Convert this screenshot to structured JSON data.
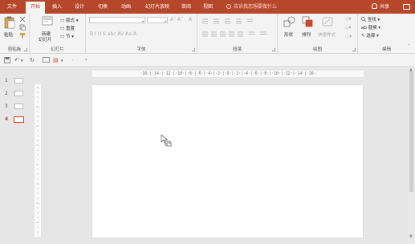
{
  "tabs": [
    "文件",
    "开始",
    "插入",
    "设计",
    "切换",
    "动画",
    "幻灯片放映",
    "审阅",
    "视图"
  ],
  "active_tab": "开始",
  "tell_me": "告诉我您想要做什么",
  "share": "共享",
  "ribbon": {
    "clipboard": {
      "paste": "粘贴",
      "label": "剪贴板"
    },
    "slides": {
      "new_slide": "新建",
      "new_slide_2": "幻灯片",
      "layout": "版式",
      "reset": "重置",
      "section": "节",
      "label": "幻灯片"
    },
    "font": {
      "label": "字体",
      "row2": "B I U S abc AV Aa A"
    },
    "paragraph": {
      "label": "段落"
    },
    "drawing": {
      "shapes": "形状",
      "arrange": "排列",
      "quick_styles": "快速样式",
      "label": "绘图"
    },
    "editing": {
      "find": "查找",
      "replace": "替换",
      "select": "选择",
      "label": "编辑"
    }
  },
  "thumbnails": [
    {
      "num": "1",
      "selected": false
    },
    {
      "num": "2",
      "selected": false
    },
    {
      "num": "3",
      "selected": false
    },
    {
      "num": "4",
      "selected": true
    }
  ],
  "ruler_h": "·16·|·14·|·12·|·10·|·8·|·6·|·4·|·2·|·0·|·2·|·4·|·6·|·8·|·10·|·12·|·14·|·16·",
  "colors": {
    "accent": "#b7472a",
    "selected": "#d24726"
  },
  "icons": [
    "lightbulb-icon",
    "share-person-icon",
    "comment-icon",
    "paste-icon",
    "cut-icon",
    "copy-icon",
    "format-painter-icon",
    "new-slide-icon",
    "shapes-icon",
    "arrange-icon",
    "quick-styles-icon",
    "find-icon",
    "replace-icon",
    "select-icon",
    "save-icon",
    "undo-icon",
    "redo-icon",
    "start-slideshow-icon"
  ]
}
